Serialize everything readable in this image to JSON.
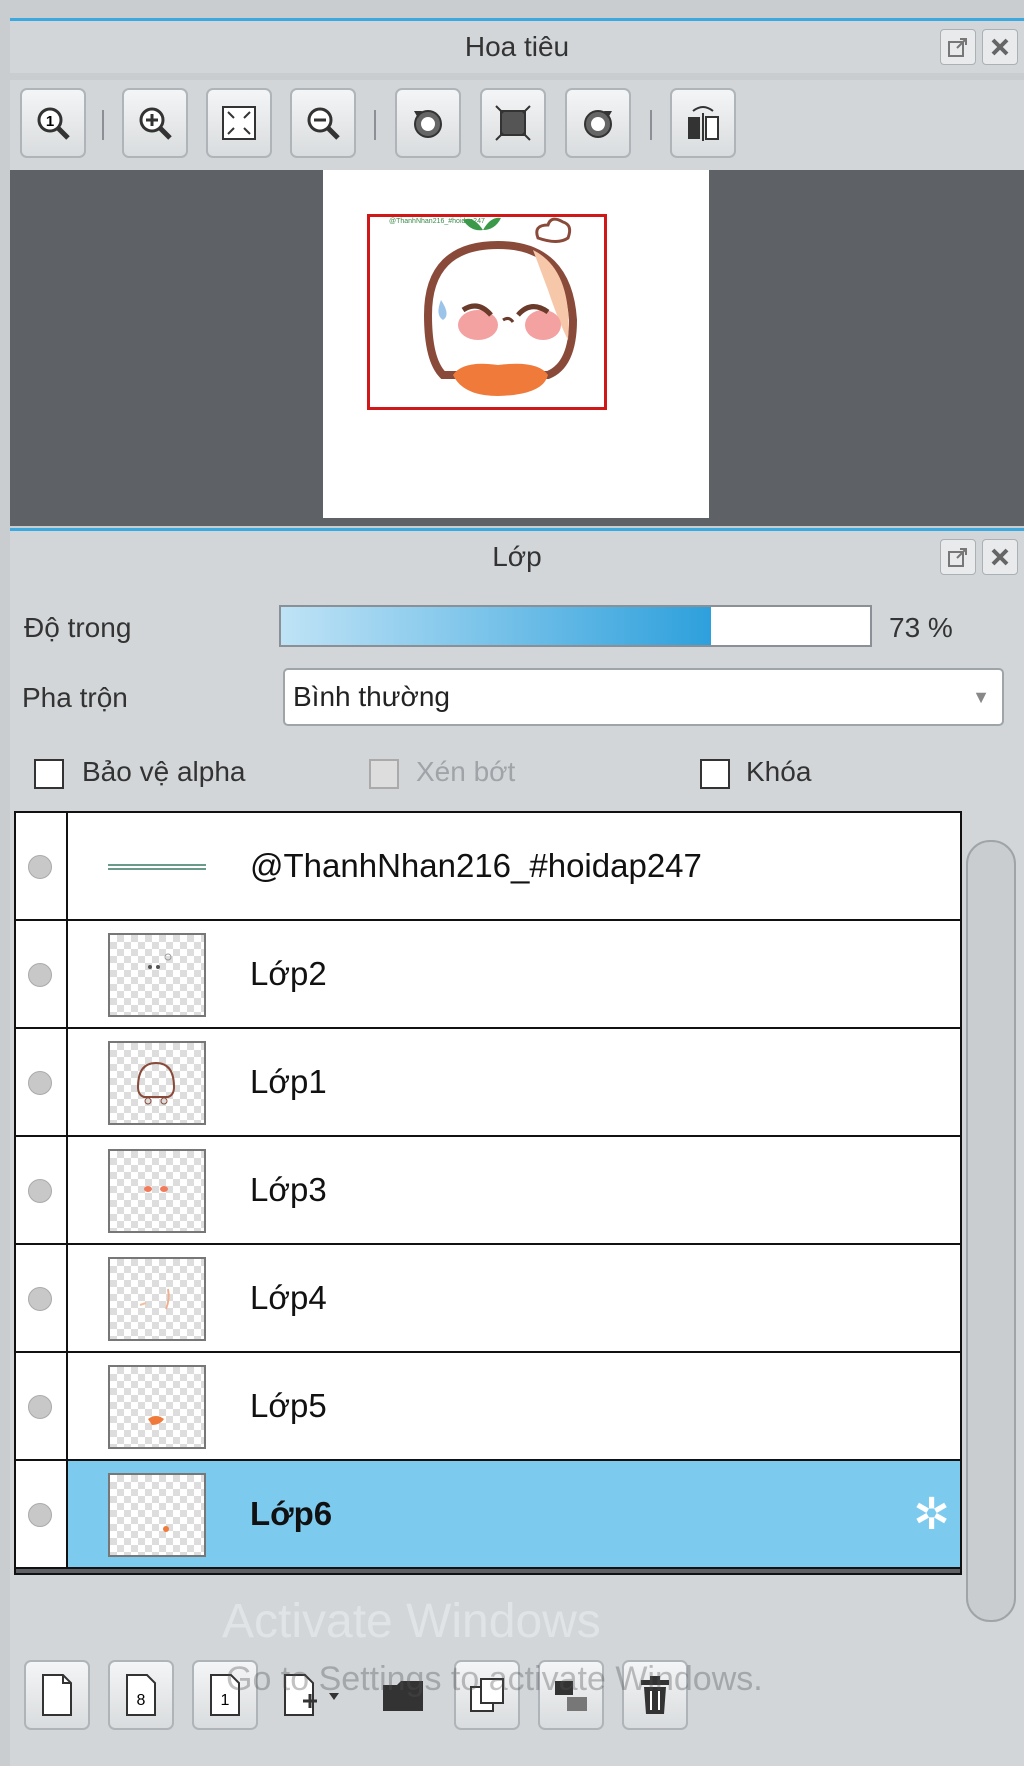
{
  "navigator": {
    "title": "Hoa tiêu",
    "toolbar": [
      "zoom-actual-icon",
      "zoom-in-icon",
      "fit-screen-icon",
      "zoom-out-icon",
      "rotate-left-icon",
      "reset-rotation-icon",
      "rotate-right-icon",
      "flip-horizontal-icon"
    ],
    "preview_text": "@ThanhNhan216_#hoidap247"
  },
  "layers_panel": {
    "title": "Lớp",
    "opacity_label": "Độ trong",
    "opacity_value": "73 %",
    "opacity_fraction": 0.73,
    "blend_label": "Pha trộn",
    "blend_value": "Bình thường",
    "alpha_protect_label": "Bảo vệ alpha",
    "clip_label": "Xén bớt",
    "lock_label": "Khóa",
    "layers": [
      {
        "name": "@ThanhNhan216_#hoidap247",
        "selected": false
      },
      {
        "name": "Lớp2",
        "selected": false
      },
      {
        "name": "Lớp1",
        "selected": false
      },
      {
        "name": "Lớp3",
        "selected": false
      },
      {
        "name": "Lớp4",
        "selected": false
      },
      {
        "name": "Lớp5",
        "selected": false
      },
      {
        "name": "Lớp6",
        "selected": true
      }
    ],
    "bottom_toolbar": [
      "new-layer-icon",
      "new-8bit-layer-icon",
      "new-1bit-layer-icon",
      "add-layer-menu-icon",
      "folder-icon",
      "duplicate-icon",
      "merge-icon",
      "trash-icon"
    ]
  },
  "watermark": {
    "line1": "Activate Windows",
    "line2": "Go to Settings to activate Windows."
  },
  "colors": {
    "accent": "#3aa9e0",
    "selected_row": "#7ccbef",
    "view_rect": "#d01818"
  }
}
